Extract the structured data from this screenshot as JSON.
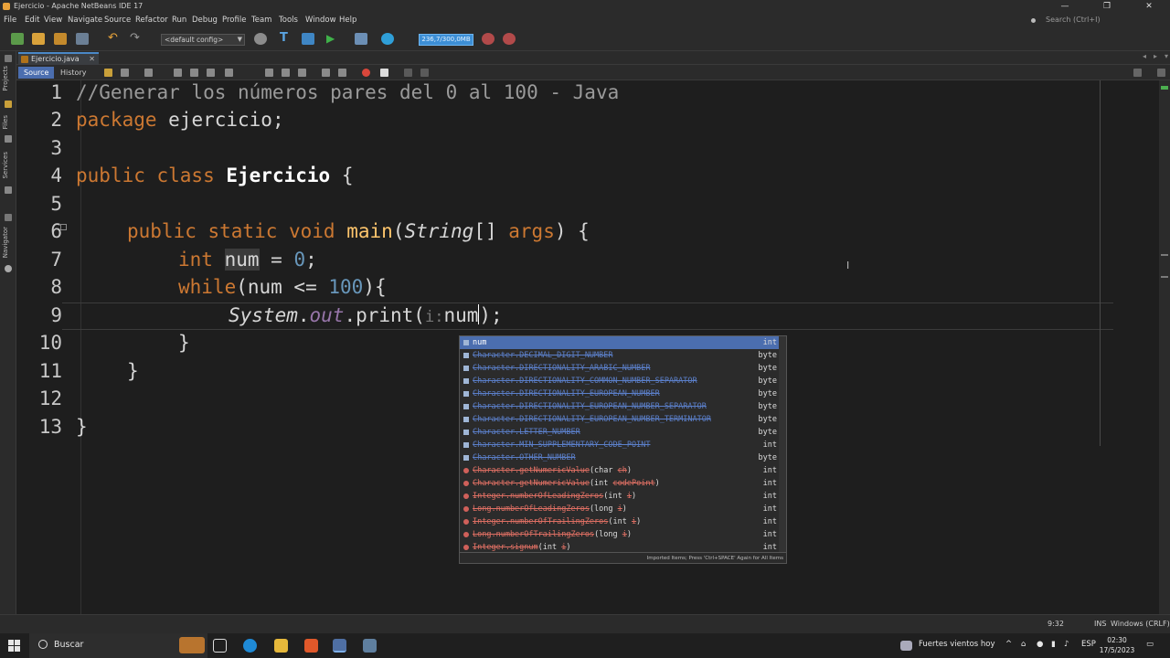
{
  "window": {
    "title": "Ejercicio - Apache NetBeans IDE 17",
    "minimize": "—",
    "maximize": "❐",
    "close": "✕"
  },
  "menu": [
    "File",
    "Edit",
    "View",
    "Navigate",
    "Source",
    "Refactor",
    "Run",
    "Debug",
    "Profile",
    "Team",
    "Tools",
    "Window",
    "Help"
  ],
  "search": {
    "placeholder": "Search (Ctrl+I)"
  },
  "toolbar": {
    "config": "<default config>",
    "memory": "236,7/300,0MB"
  },
  "side_panels": [
    "Projects",
    "Files",
    "Services",
    "Navigator"
  ],
  "editor_tab": {
    "label": "Ejercicio.java",
    "close": "✕"
  },
  "editor_views": {
    "source": "Source",
    "history": "History"
  },
  "code": {
    "line_numbers": [
      "1",
      "2",
      "3",
      "4",
      "5",
      "6",
      "7",
      "8",
      "9",
      "10",
      "11",
      "12",
      "13"
    ],
    "l1": "//Generar los números pares del 0 al 100 - Java",
    "l2_kw": "package",
    "l2_rest": " ejercicio;",
    "l4_kw": "public class",
    "l4_name": "Ejercicio",
    "l4_rest": " {",
    "l6_kw": "public static void",
    "l6_fn": "main",
    "l6_open": "(",
    "l6_type": "String",
    "l6_arr": "[] ",
    "l6_arg": "args",
    "l6_close": ") {",
    "l7_kw": "int",
    "l7_var": "num",
    "l7_eq": " = ",
    "l7_val": "0",
    "l7_end": ";",
    "l8_kw": "while",
    "l8_a": "(num <= ",
    "l8_val": "100",
    "l8_b": "){",
    "l9_sys": "System",
    "l9_dot1": ".",
    "l9_out": "out",
    "l9_print": ".print(",
    "l9_hint": "i:",
    "l9_arg": "num",
    "l9_end": ");",
    "l10": "}",
    "l11": "}",
    "l13": "}"
  },
  "completion": {
    "items": [
      {
        "kind": "field",
        "name": "num",
        "type": "int"
      },
      {
        "kind": "field",
        "cls": "Character.DECIMAL_DIGIT_NUMBER",
        "type": "byte"
      },
      {
        "kind": "field",
        "cls": "Character.DIRECTIONALITY_ARABIC_NUMBER",
        "type": "byte"
      },
      {
        "kind": "field",
        "cls": "Character.DIRECTIONALITY_COMMON_NUMBER_SEPARATOR",
        "type": "byte"
      },
      {
        "kind": "field",
        "cls": "Character.DIRECTIONALITY_EUROPEAN_NUMBER",
        "type": "byte"
      },
      {
        "kind": "field",
        "cls": "Character.DIRECTIONALITY_EUROPEAN_NUMBER_SEPARATOR",
        "type": "byte"
      },
      {
        "kind": "field",
        "cls": "Character.DIRECTIONALITY_EUROPEAN_NUMBER_TERMINATOR",
        "type": "byte"
      },
      {
        "kind": "field",
        "cls": "Character.LETTER_NUMBER",
        "type": "byte"
      },
      {
        "kind": "field",
        "cls": "Character.MIN_SUPPLEMENTARY_CODE_POINT",
        "type": "int"
      },
      {
        "kind": "field",
        "cls": "Character.OTHER_NUMBER",
        "type": "byte"
      },
      {
        "kind": "method",
        "cls": "Character.getNumericValue",
        "pre": "(char ",
        "arg": "ch",
        "post": ")",
        "type": "int"
      },
      {
        "kind": "method",
        "cls": "Character.getNumericValue",
        "pre": "(int ",
        "arg": "codePoint",
        "post": ")",
        "type": "int"
      },
      {
        "kind": "method",
        "cls": "Integer.numberOfLeadingZeros",
        "pre": "(int ",
        "arg": "i",
        "post": ")",
        "type": "int"
      },
      {
        "kind": "method",
        "cls": "Long.numberOfLeadingZeros",
        "pre": "(long ",
        "arg": "i",
        "post": ")",
        "type": "int"
      },
      {
        "kind": "method",
        "cls": "Integer.numberOfTrailingZeros",
        "pre": "(int ",
        "arg": "i",
        "post": ")",
        "type": "int"
      },
      {
        "kind": "method",
        "cls": "Long.numberOfTrailingZeros",
        "pre": "(long ",
        "arg": "i",
        "post": ")",
        "type": "int"
      },
      {
        "kind": "method",
        "cls": "Integer.signum",
        "pre": "(int ",
        "arg": "i",
        "post": ")",
        "type": "int"
      }
    ],
    "footer": "Imported Items; Press 'Ctrl+SPACE' Again for All Items"
  },
  "status": {
    "position": "9:32",
    "mode": "INS",
    "line_ending": "Windows (CRLF)"
  },
  "taskbar": {
    "search": "Buscar",
    "weather": "Fuertes vientos hoy",
    "lang": "ESP",
    "time": "02:30",
    "date": "17/5/2023"
  }
}
